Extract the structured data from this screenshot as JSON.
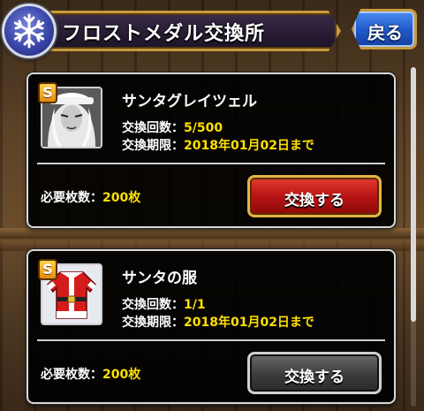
{
  "header": {
    "title": "フロストメダル交換所",
    "back_label": "戻る",
    "emblem_icon": "snowflake-icon"
  },
  "scroll": {
    "position_fraction": 0.0,
    "visible_fraction": 0.75
  },
  "items": [
    {
      "rank": "S",
      "name": "サンタグレイツェル",
      "exchange_count_label": "交換回数：",
      "exchange_count_value": "5/500",
      "deadline_label": "交換期限：",
      "deadline_value": "2018年01月02日まで",
      "cost_label": "必要枚数：",
      "cost_value": "200枚",
      "button_label": "交換する",
      "button_state": "active",
      "icon": "character-portrait-icon"
    },
    {
      "rank": "S",
      "name": "サンタの服",
      "exchange_count_label": "交換回数：",
      "exchange_count_value": "1/1",
      "deadline_label": "交換期限：",
      "deadline_value": "2018年01月02日まで",
      "cost_label": "必要枚数：",
      "cost_value": "200枚",
      "button_label": "交換する",
      "button_state": "disabled",
      "icon": "santa-coat-icon"
    }
  ],
  "colors": {
    "accent_gold": "#e3b441",
    "value_yellow": "#ffe000",
    "button_red": "#b81414",
    "button_gray": "#3c3c3c",
    "back_blue": "#1f58c8"
  }
}
